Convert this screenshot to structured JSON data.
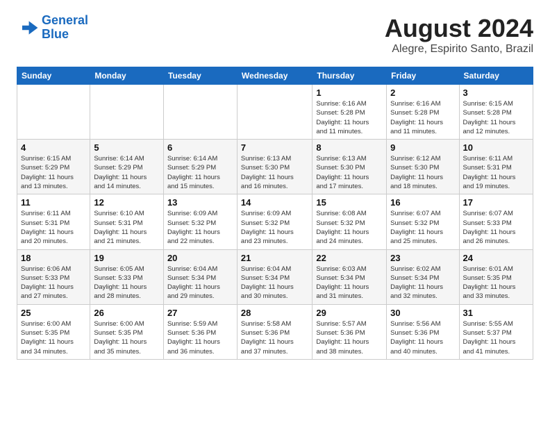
{
  "logo": {
    "line1": "General",
    "line2": "Blue"
  },
  "header": {
    "month_year": "August 2024",
    "location": "Alegre, Espirito Santo, Brazil"
  },
  "weekdays": [
    "Sunday",
    "Monday",
    "Tuesday",
    "Wednesday",
    "Thursday",
    "Friday",
    "Saturday"
  ],
  "weeks": [
    [
      {
        "day": "",
        "info": ""
      },
      {
        "day": "",
        "info": ""
      },
      {
        "day": "",
        "info": ""
      },
      {
        "day": "",
        "info": ""
      },
      {
        "day": "1",
        "info": "Sunrise: 6:16 AM\nSunset: 5:28 PM\nDaylight: 11 hours\nand 11 minutes."
      },
      {
        "day": "2",
        "info": "Sunrise: 6:16 AM\nSunset: 5:28 PM\nDaylight: 11 hours\nand 11 minutes."
      },
      {
        "day": "3",
        "info": "Sunrise: 6:15 AM\nSunset: 5:28 PM\nDaylight: 11 hours\nand 12 minutes."
      }
    ],
    [
      {
        "day": "4",
        "info": "Sunrise: 6:15 AM\nSunset: 5:29 PM\nDaylight: 11 hours\nand 13 minutes."
      },
      {
        "day": "5",
        "info": "Sunrise: 6:14 AM\nSunset: 5:29 PM\nDaylight: 11 hours\nand 14 minutes."
      },
      {
        "day": "6",
        "info": "Sunrise: 6:14 AM\nSunset: 5:29 PM\nDaylight: 11 hours\nand 15 minutes."
      },
      {
        "day": "7",
        "info": "Sunrise: 6:13 AM\nSunset: 5:30 PM\nDaylight: 11 hours\nand 16 minutes."
      },
      {
        "day": "8",
        "info": "Sunrise: 6:13 AM\nSunset: 5:30 PM\nDaylight: 11 hours\nand 17 minutes."
      },
      {
        "day": "9",
        "info": "Sunrise: 6:12 AM\nSunset: 5:30 PM\nDaylight: 11 hours\nand 18 minutes."
      },
      {
        "day": "10",
        "info": "Sunrise: 6:11 AM\nSunset: 5:31 PM\nDaylight: 11 hours\nand 19 minutes."
      }
    ],
    [
      {
        "day": "11",
        "info": "Sunrise: 6:11 AM\nSunset: 5:31 PM\nDaylight: 11 hours\nand 20 minutes."
      },
      {
        "day": "12",
        "info": "Sunrise: 6:10 AM\nSunset: 5:31 PM\nDaylight: 11 hours\nand 21 minutes."
      },
      {
        "day": "13",
        "info": "Sunrise: 6:09 AM\nSunset: 5:32 PM\nDaylight: 11 hours\nand 22 minutes."
      },
      {
        "day": "14",
        "info": "Sunrise: 6:09 AM\nSunset: 5:32 PM\nDaylight: 11 hours\nand 23 minutes."
      },
      {
        "day": "15",
        "info": "Sunrise: 6:08 AM\nSunset: 5:32 PM\nDaylight: 11 hours\nand 24 minutes."
      },
      {
        "day": "16",
        "info": "Sunrise: 6:07 AM\nSunset: 5:32 PM\nDaylight: 11 hours\nand 25 minutes."
      },
      {
        "day": "17",
        "info": "Sunrise: 6:07 AM\nSunset: 5:33 PM\nDaylight: 11 hours\nand 26 minutes."
      }
    ],
    [
      {
        "day": "18",
        "info": "Sunrise: 6:06 AM\nSunset: 5:33 PM\nDaylight: 11 hours\nand 27 minutes."
      },
      {
        "day": "19",
        "info": "Sunrise: 6:05 AM\nSunset: 5:33 PM\nDaylight: 11 hours\nand 28 minutes."
      },
      {
        "day": "20",
        "info": "Sunrise: 6:04 AM\nSunset: 5:34 PM\nDaylight: 11 hours\nand 29 minutes."
      },
      {
        "day": "21",
        "info": "Sunrise: 6:04 AM\nSunset: 5:34 PM\nDaylight: 11 hours\nand 30 minutes."
      },
      {
        "day": "22",
        "info": "Sunrise: 6:03 AM\nSunset: 5:34 PM\nDaylight: 11 hours\nand 31 minutes."
      },
      {
        "day": "23",
        "info": "Sunrise: 6:02 AM\nSunset: 5:34 PM\nDaylight: 11 hours\nand 32 minutes."
      },
      {
        "day": "24",
        "info": "Sunrise: 6:01 AM\nSunset: 5:35 PM\nDaylight: 11 hours\nand 33 minutes."
      }
    ],
    [
      {
        "day": "25",
        "info": "Sunrise: 6:00 AM\nSunset: 5:35 PM\nDaylight: 11 hours\nand 34 minutes."
      },
      {
        "day": "26",
        "info": "Sunrise: 6:00 AM\nSunset: 5:35 PM\nDaylight: 11 hours\nand 35 minutes."
      },
      {
        "day": "27",
        "info": "Sunrise: 5:59 AM\nSunset: 5:36 PM\nDaylight: 11 hours\nand 36 minutes."
      },
      {
        "day": "28",
        "info": "Sunrise: 5:58 AM\nSunset: 5:36 PM\nDaylight: 11 hours\nand 37 minutes."
      },
      {
        "day": "29",
        "info": "Sunrise: 5:57 AM\nSunset: 5:36 PM\nDaylight: 11 hours\nand 38 minutes."
      },
      {
        "day": "30",
        "info": "Sunrise: 5:56 AM\nSunset: 5:36 PM\nDaylight: 11 hours\nand 40 minutes."
      },
      {
        "day": "31",
        "info": "Sunrise: 5:55 AM\nSunset: 5:37 PM\nDaylight: 11 hours\nand 41 minutes."
      }
    ]
  ]
}
